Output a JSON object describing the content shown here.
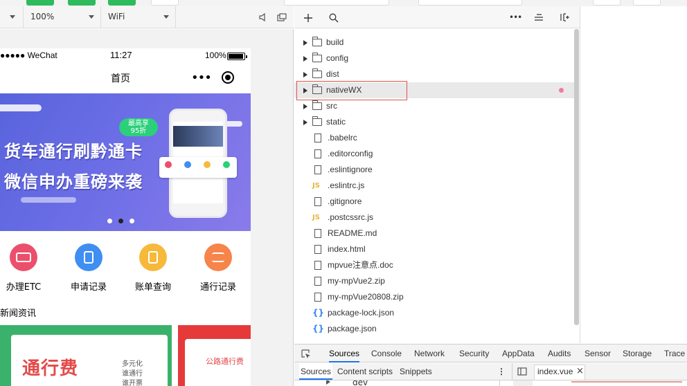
{
  "simulator_toolbar": {
    "zoom": "100%",
    "network": "WiFi"
  },
  "phone": {
    "status_carrier": "●●●●● WeChat",
    "status_time": "11:27",
    "status_battery": "100%",
    "nav_title": "首页",
    "banner": {
      "line1": "货车通行刷黔通卡",
      "line2": "微信申办重磅来袭",
      "badge_line1": "最高享",
      "badge_line2": "95折"
    },
    "shortcuts": [
      {
        "label": "办理ETC",
        "color": "#ec4f6b",
        "icon": "etc-icon"
      },
      {
        "label": "申请记录",
        "color": "#3f8ef2",
        "icon": "document-icon"
      },
      {
        "label": "账单查询",
        "color": "#f6b93b",
        "icon": "bill-icon"
      },
      {
        "label": "通行记录",
        "color": "#f7844a",
        "icon": "list-icon"
      }
    ],
    "news_title": "新闻资讯",
    "news": [
      {
        "title": "通行费",
        "sub1": "多元化",
        "sub2": "谁通行",
        "sub3": "谁开票"
      },
      {
        "title": "公路通行费"
      }
    ]
  },
  "file_tree": {
    "items": [
      {
        "name": "build",
        "type": "folder"
      },
      {
        "name": "config",
        "type": "folder"
      },
      {
        "name": "dist",
        "type": "folder"
      },
      {
        "name": "nativeWX",
        "type": "folder",
        "selected": true
      },
      {
        "name": "src",
        "type": "folder"
      },
      {
        "name": "static",
        "type": "folder"
      },
      {
        "name": ".babelrc",
        "type": "file"
      },
      {
        "name": ".editorconfig",
        "type": "file"
      },
      {
        "name": ".eslintignore",
        "type": "file"
      },
      {
        "name": ".eslintrc.js",
        "type": "js"
      },
      {
        "name": ".gitignore",
        "type": "file"
      },
      {
        "name": ".postcssrc.js",
        "type": "js"
      },
      {
        "name": "README.md",
        "type": "file"
      },
      {
        "name": "index.html",
        "type": "file"
      },
      {
        "name": "mpvue注意点.doc",
        "type": "file"
      },
      {
        "name": "my-mpVue2.zip",
        "type": "file"
      },
      {
        "name": "my-mpVue20808.zip",
        "type": "file"
      },
      {
        "name": "package-lock.json",
        "type": "json"
      },
      {
        "name": "package.json",
        "type": "json"
      }
    ]
  },
  "devtools": {
    "tabs": [
      "Sources",
      "Console",
      "Network",
      "Security",
      "AppData",
      "Audits",
      "Sensor",
      "Storage",
      "Trace"
    ],
    "active_tab": "Sources",
    "subtabs": [
      "Sources",
      "Content scripts",
      "Snippets"
    ],
    "open_file": "index.vue",
    "tree_item": "dev",
    "more": "⋮",
    "close": "×"
  },
  "colors": {
    "selection_outline": "#e0504a",
    "active_tab_underline": "#1a73e8",
    "top_green": "#2dbb5d"
  }
}
